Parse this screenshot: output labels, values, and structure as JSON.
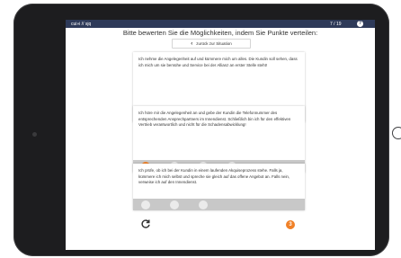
{
  "topbar": {
    "breadcrumb": "cui»i // sjq",
    "counter": "7 / 19",
    "help_label": "?"
  },
  "title": "Bitte bewerten Sie die Möglichkeiten, indem Sie Punkte verteilen:",
  "back_button": {
    "icon": "chevron-left-icon",
    "label": "zurück zur Situation"
  },
  "options": [
    {
      "text": "Ich nehme die Angelegenheit auf und kümmere mich um alles. Die Kundin soll sehen, dass ich mich um sie bemühe und Service bei der Allianz an erster Stelle steht!",
      "points": 2,
      "max": 5
    },
    {
      "text": "Ich höre mir die Angelegenheit an und gebe der Kundin die Telefonnummer des entsprechenden Ansprechpartners im Innendienst. Schließlich bin ich für den effektiven Vertrieb verantwortlich und nicht für die Schadensabwicklung!",
      "points": 1,
      "max": 4
    },
    {
      "text": "Ich prüfe, ob ich bei der Kundin in einem laufenden Akquiseprozess stehe. Falls ja, kümmere ich mich selbst und spreche sie gleich auf das offene Angebot an. Falls nein, verweise ich auf den Innendienst.",
      "points": 0,
      "max": 3
    }
  ],
  "footer": {
    "reset_icon": "reset-icon",
    "remaining_points": "3"
  },
  "colors": {
    "accent": "#f08128",
    "header": "#2e3a59",
    "rating_bar": "#c8c8c8",
    "dot_empty": "#ebebeb"
  }
}
